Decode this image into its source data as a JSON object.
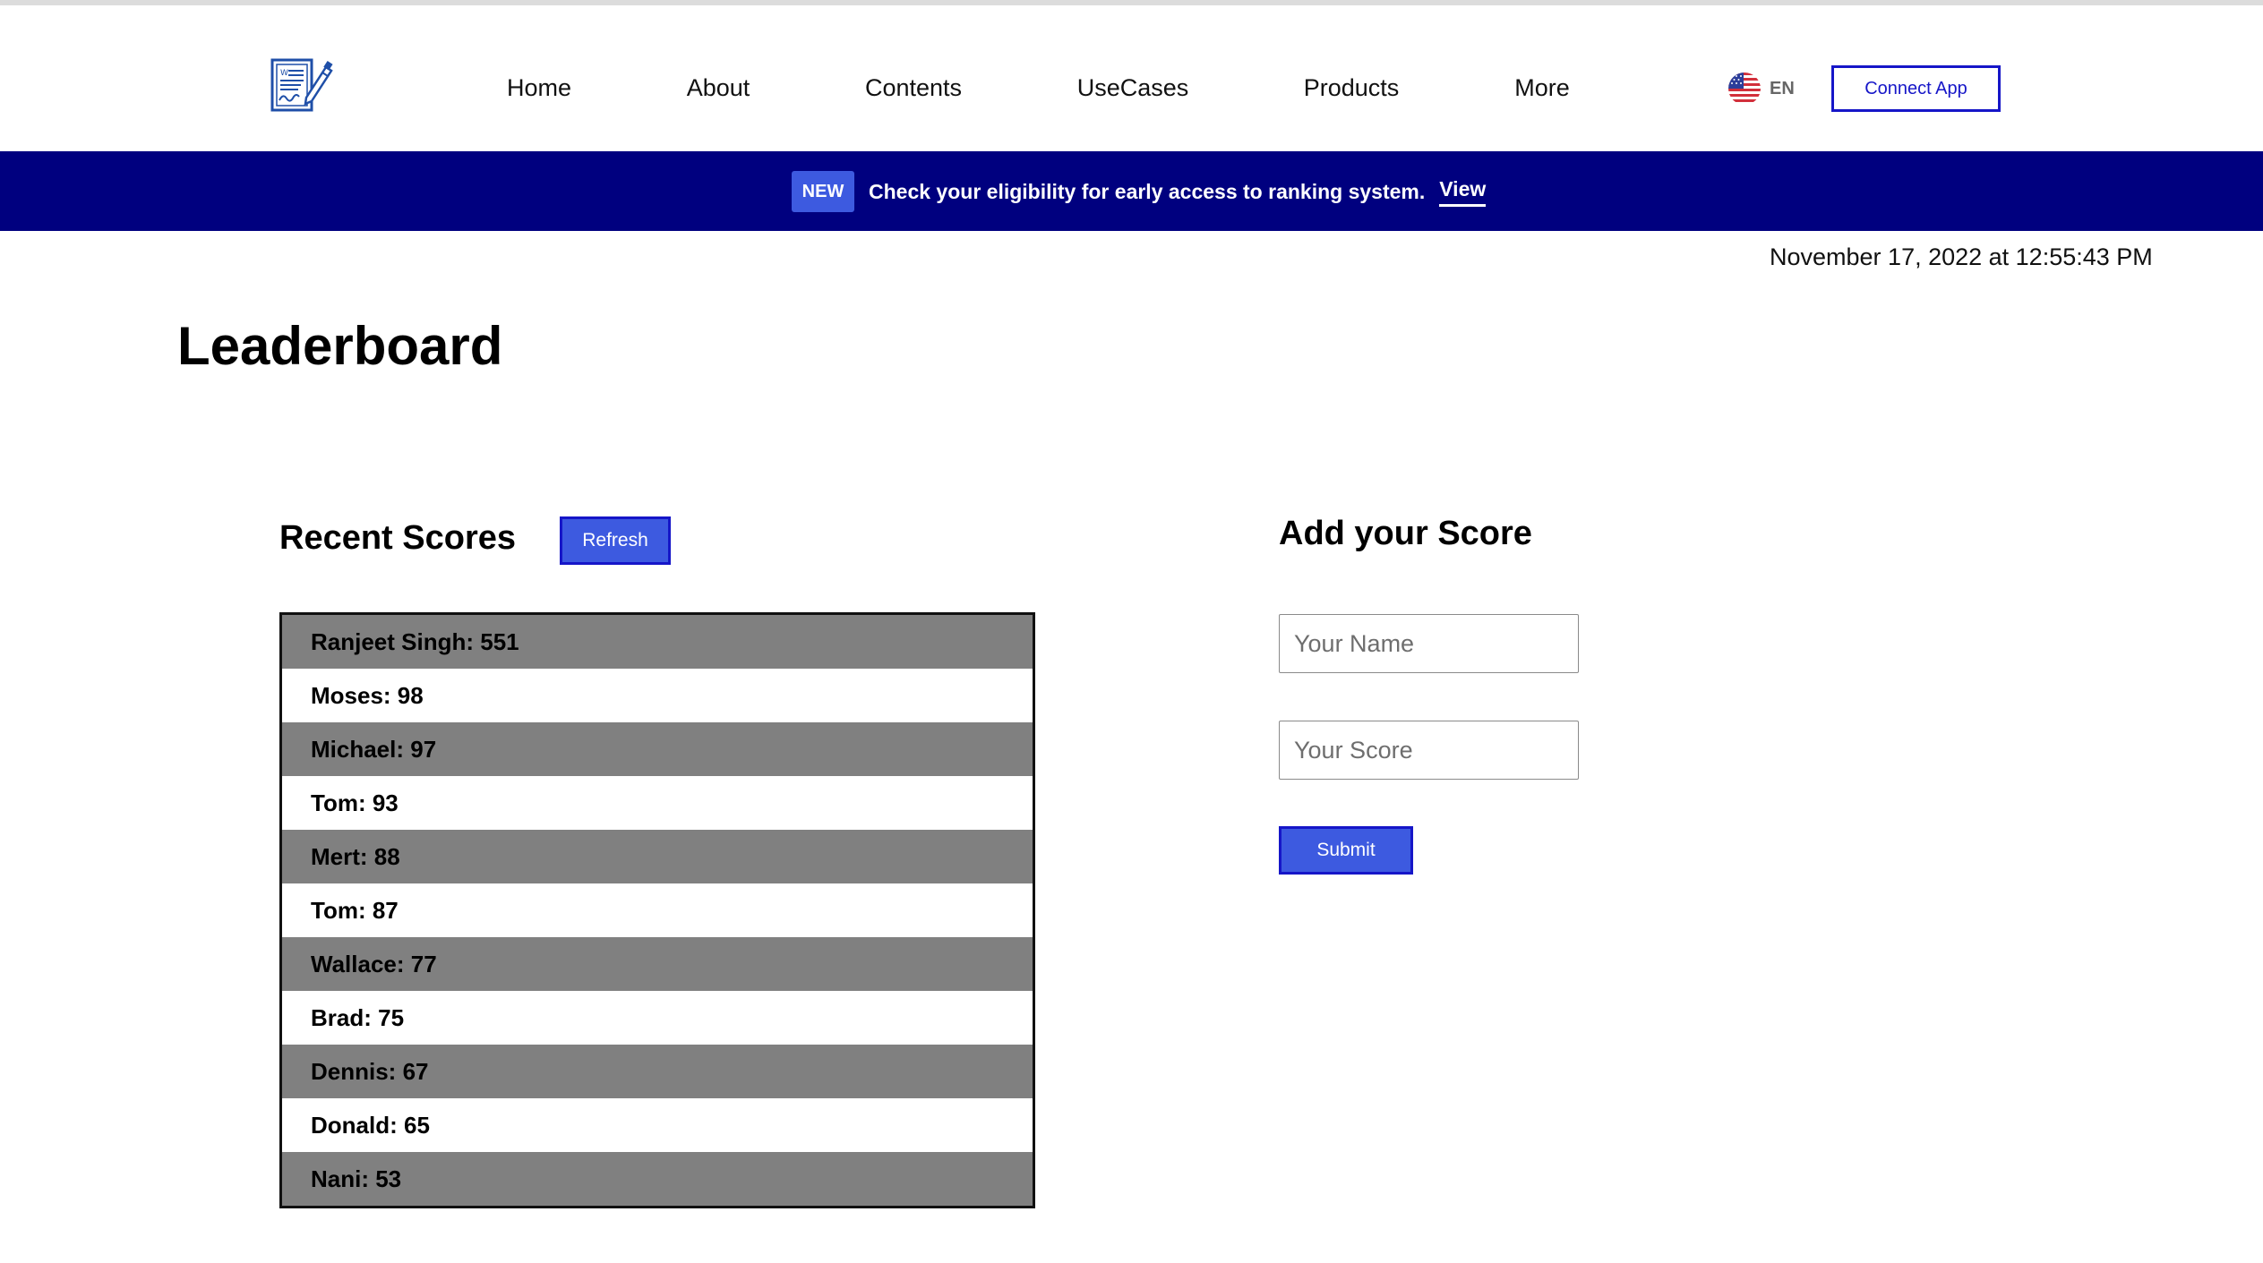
{
  "header": {
    "logo_icon": "signed-document-icon",
    "nav": [
      {
        "label": "Home"
      },
      {
        "label": "About"
      },
      {
        "label": "Contents"
      },
      {
        "label": "UseCases"
      },
      {
        "label": "Products"
      },
      {
        "label": "More"
      }
    ],
    "language": {
      "icon": "us-flag-icon",
      "label": "EN"
    },
    "connect_label": "Connect App"
  },
  "banner": {
    "badge": "NEW",
    "message": "Check your eligibility for early access to ranking system.",
    "link_label": "View"
  },
  "timestamp": "November 17, 2022 at 12:55:43 PM",
  "page_title": "Leaderboard",
  "recent_scores": {
    "heading": "Recent Scores",
    "refresh_label": "Refresh",
    "entries": [
      "Ranjeet Singh: 551",
      "Moses: 98",
      "Michael: 97",
      "Tom: 93",
      "Mert: 88",
      "Tom: 87",
      "Wallace: 77",
      "Brad: 75",
      "Dennis: 67",
      "Donald: 65",
      "Nani: 53"
    ]
  },
  "add_score": {
    "heading": "Add your Score",
    "name_placeholder": "Your Name",
    "score_placeholder": "Your Score",
    "submit_label": "Submit"
  },
  "colors": {
    "banner_bg": "#00007f",
    "accent_blue": "#3d5ae0",
    "border_blue": "#1616c8",
    "row_shade": "#808080"
  }
}
